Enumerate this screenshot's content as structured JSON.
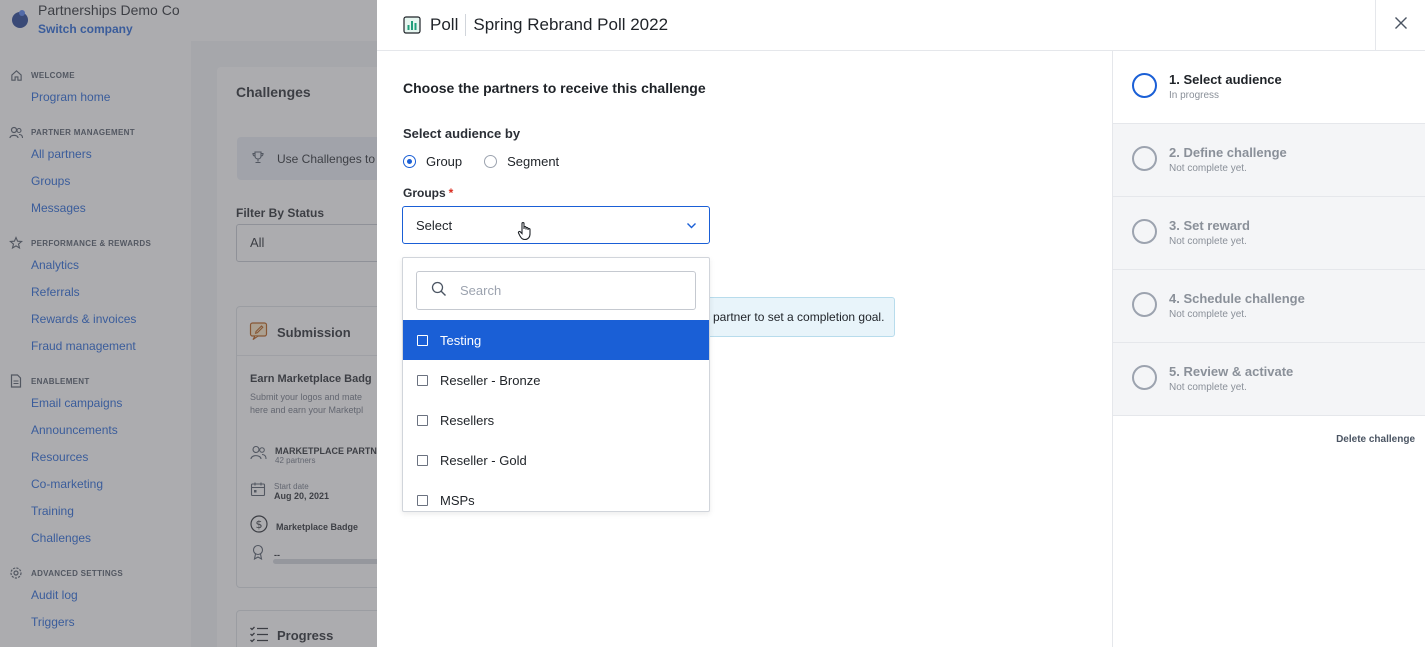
{
  "company": {
    "name": "Partnerships Demo Co",
    "switch_label": "Switch company"
  },
  "nav": {
    "sections": [
      {
        "label": "WELCOME",
        "icon": "home-icon",
        "items": [
          "Program home"
        ]
      },
      {
        "label": "PARTNER MANAGEMENT",
        "icon": "users-icon",
        "items": [
          "All partners",
          "Groups",
          "Messages"
        ]
      },
      {
        "label": "PERFORMANCE & REWARDS",
        "icon": "star-icon",
        "items": [
          "Analytics",
          "Referrals",
          "Rewards & invoices",
          "Fraud management"
        ]
      },
      {
        "label": "ENABLEMENT",
        "icon": "document-icon",
        "items": [
          "Email campaigns",
          "Announcements",
          "Resources",
          "Co-marketing",
          "Training",
          "Challenges"
        ]
      },
      {
        "label": "ADVANCED SETTINGS",
        "icon": "gear-icon",
        "items": [
          "Audit log",
          "Triggers"
        ]
      }
    ]
  },
  "background": {
    "panel_title": "Challenges",
    "banner_text": "Use Challenges to",
    "filter_label": "Filter By Status",
    "filter_value": "All",
    "card": {
      "heading": "Submission",
      "title": "Earn Marketplace Badg",
      "desc_line1": "Submit your logos and mate",
      "desc_line2": "here and earn your Marketpl",
      "audience": "MARKETPLACE PARTN",
      "audience_count": "42 partners",
      "start_label": "Start date",
      "start_value": "Aug 20, 2021",
      "reward": "Marketplace Badge",
      "goal": "--"
    },
    "card2_heading": "Progress"
  },
  "modal": {
    "type_label": "Poll",
    "poll_name": "Spring Rebrand Poll 2022",
    "content_title": "Choose the partners to receive this challenge",
    "select_by_label": "Select audience by",
    "radio_group": "Group",
    "radio_segment": "Segment",
    "groups_label": "Groups",
    "required_mark": "*",
    "select_placeholder": "Select",
    "search_placeholder": "Search",
    "hint_text": "partner to set a completion goal.",
    "options": [
      "Testing",
      "Reseller - Bronze",
      "Resellers",
      "Reseller - Gold",
      "MSPs"
    ]
  },
  "steps": [
    {
      "name": "1. Select audience",
      "status": "In progress"
    },
    {
      "name": "2. Define challenge",
      "status": "Not complete yet."
    },
    {
      "name": "3. Set reward",
      "status": "Not complete yet."
    },
    {
      "name": "4. Schedule challenge",
      "status": "Not complete yet."
    },
    {
      "name": "5. Review & activate",
      "status": "Not complete yet."
    }
  ],
  "delete_label": "Delete challenge",
  "colors": {
    "accent": "#1a5fd6",
    "required": "#d92d20",
    "poll_icon": "#1f9e7a"
  }
}
